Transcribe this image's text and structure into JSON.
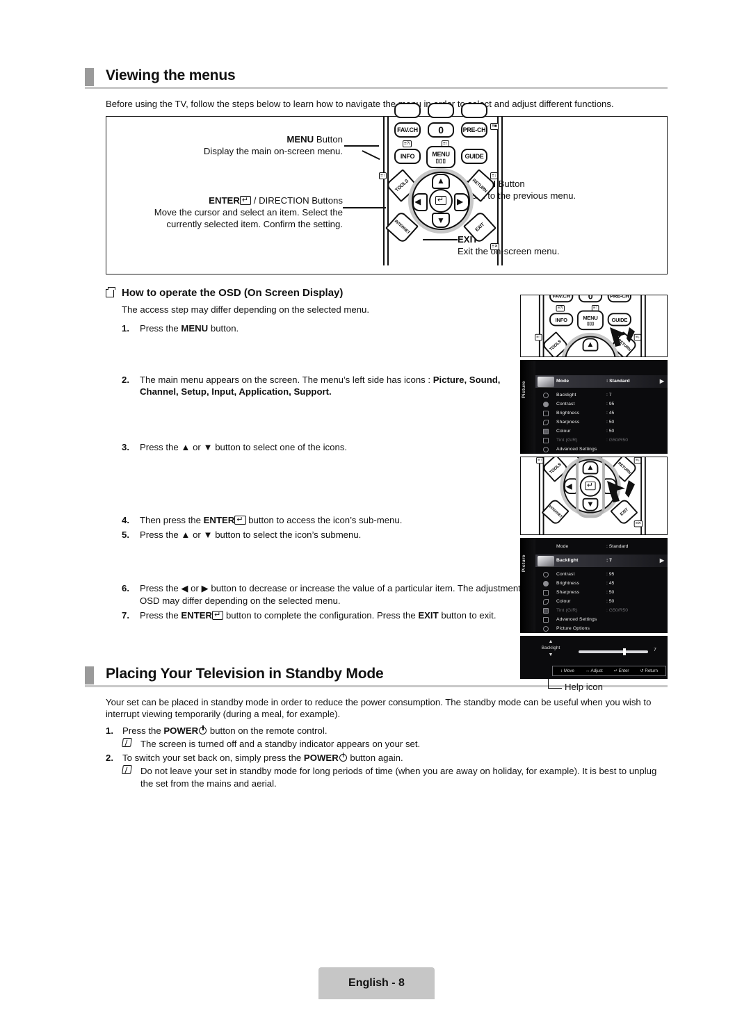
{
  "page": {
    "footer_label": "English - 8"
  },
  "section1": {
    "title": "Viewing the menus",
    "intro": "Before using the TV, follow the steps below to learn how to navigate the menu in order to select and adjust different functions.",
    "diagram": {
      "menu_label_bold": "MENU",
      "menu_label_rest": " Button",
      "menu_desc": "Display the main on-screen menu.",
      "enter_label_bold": "ENTER",
      "enter_label_rest": " / DIRECTION Buttons",
      "enter_desc": "Move the cursor and select an item. Select the currently selected item. Confirm the setting.",
      "return_label_bold": "RETURN",
      "return_label_rest": " Button",
      "return_desc": "Return to the previous menu.",
      "exit_label_bold": "EXIT",
      "exit_desc": "Exit the on-screen menu.",
      "remote_buttons": {
        "fav_ch": "FAV.CH",
        "zero": "0",
        "pre_ch": "PRE-CH",
        "info": "INFO",
        "menu": "MENU",
        "guide": "GUIDE",
        "tools": "TOOLS",
        "return": "RETURN",
        "internet": "INTERNET",
        "exit": "EXIT"
      }
    }
  },
  "osd_section": {
    "heading": "How to operate the OSD (On Screen Display)",
    "note": "The access step may differ depending on the selected menu.",
    "steps": [
      {
        "n": "1.",
        "parts": [
          {
            "t": "Press the ",
            "b": false
          },
          {
            "t": "MENU",
            "b": true
          },
          {
            "t": " button.",
            "b": false
          }
        ]
      },
      {
        "n": "2.",
        "parts": [
          {
            "t": "The main menu appears on the screen. The menu’s left side has icons : ",
            "b": false
          },
          {
            "t": "Picture, Sound, Channel, Setup, Input, Application, Support.",
            "b": true
          }
        ]
      },
      {
        "n": "3.",
        "parts": [
          {
            "t": "Press the ▲ or ▼ button to select one of the icons.",
            "b": false
          }
        ]
      },
      {
        "n": "4.",
        "parts": [
          {
            "t": "Then press the ",
            "b": false
          },
          {
            "t": "ENTER",
            "b": true
          },
          {
            "t": "ENTERKEY",
            "b": false
          },
          {
            "t": " button to access the icon’s sub-menu.",
            "b": false
          }
        ]
      },
      {
        "n": "5.",
        "parts": [
          {
            "t": "Press the ▲ or ▼ button to select the icon’s submenu.",
            "b": false
          }
        ]
      },
      {
        "n": "6.",
        "parts": [
          {
            "t": "Press the ◀ or ▶ button to decrease or increase the value of a particular item. The adjustment OSD may differ depending on the selected menu.",
            "b": false
          }
        ]
      },
      {
        "n": "7.",
        "parts": [
          {
            "t": "Press the ",
            "b": false
          },
          {
            "t": "ENTER",
            "b": true
          },
          {
            "t": "ENTERKEY",
            "b": false
          },
          {
            "t": " button to complete the configuration. Press the ",
            "b": false
          },
          {
            "t": "EXIT",
            "b": true
          },
          {
            "t": " button to exit.",
            "b": false
          }
        ]
      }
    ],
    "help_icon_caption": "Help icon"
  },
  "osd_menu_1": {
    "sidebar_label": "Picture",
    "rows": [
      {
        "icon": "tv-icon",
        "name": "Mode",
        "value": ": Standard",
        "state": "selected",
        "arrow": "▶"
      },
      {
        "icon": "backlight-icon",
        "name": "Backlight",
        "value": ": 7",
        "state": "normal",
        "arrow": ""
      },
      {
        "icon": "contrast-icon",
        "name": "Contrast",
        "value": ": 95",
        "state": "normal",
        "arrow": ""
      },
      {
        "icon": "brightness-icon",
        "name": "Brightness",
        "value": ": 45",
        "state": "normal",
        "arrow": ""
      },
      {
        "icon": "sharpness-icon",
        "name": "Sharpness",
        "value": ": 50",
        "state": "normal",
        "arrow": ""
      },
      {
        "icon": "colour-icon",
        "name": "Colour",
        "value": ": 50",
        "state": "normal",
        "arrow": ""
      },
      {
        "icon": "tint-icon",
        "name": "Tint (G/R)",
        "value": ": G50/R50",
        "state": "dim",
        "arrow": ""
      },
      {
        "icon": "advanced-icon",
        "name": "Advanced Settings",
        "value": "",
        "state": "normal",
        "arrow": ""
      }
    ]
  },
  "osd_menu_2": {
    "sidebar_label": "Picture",
    "rows": [
      {
        "icon": "none",
        "name": "Mode",
        "value": ": Standard",
        "state": "normal",
        "arrow": ""
      },
      {
        "icon": "tv-icon",
        "name": "Backlight",
        "value": ": 7",
        "state": "selected",
        "arrow": "▶"
      },
      {
        "icon": "contrast-icon",
        "name": "Contrast",
        "value": ": 95",
        "state": "normal",
        "arrow": ""
      },
      {
        "icon": "brightness-icon",
        "name": "Brightness",
        "value": ": 45",
        "state": "normal",
        "arrow": ""
      },
      {
        "icon": "sharpness-icon",
        "name": "Sharpness",
        "value": ": 50",
        "state": "normal",
        "arrow": ""
      },
      {
        "icon": "colour-icon",
        "name": "Colour",
        "value": ": 50",
        "state": "normal",
        "arrow": ""
      },
      {
        "icon": "tint-icon",
        "name": "Tint (G/R)",
        "value": ": G50/R50",
        "state": "dim",
        "arrow": ""
      },
      {
        "icon": "advanced-icon",
        "name": "Advanced Settings",
        "value": "",
        "state": "normal",
        "arrow": ""
      },
      {
        "icon": "options-icon",
        "name": "Picture Options",
        "value": "",
        "state": "normal",
        "arrow": ""
      }
    ]
  },
  "osd_slider": {
    "label": "Backlight",
    "up_glyph": "▲",
    "down_glyph": "▼",
    "value": "7",
    "help": [
      {
        "glyph": "↕",
        "label": "Move"
      },
      {
        "glyph": "↔",
        "label": "Adjust"
      },
      {
        "glyph": "↵",
        "label": "Enter"
      },
      {
        "glyph": "↺",
        "label": "Return"
      }
    ]
  },
  "section2": {
    "title": "Placing Your Television in Standby Mode",
    "body": "Your set can be placed in standby mode in order to reduce the power consumption. The standby mode can be useful when you wish to interrupt viewing temporarily (during a meal, for example).",
    "step1_a": "Press the ",
    "step1_b": "POWER",
    "step1_c": " button on the remote control.",
    "note1": "The screen is turned off and a standby indicator appears on your set.",
    "step2_a": "To switch your set back on, simply press the ",
    "step2_b": "POWER",
    "step2_c": " button again.",
    "note2": "Do not leave your set in standby mode for long periods of time (when you are away on holiday, for example). It is best to unplug the set from the mains and aerial.",
    "n1": "1.",
    "n2": "2."
  },
  "colors": {
    "heading_bar": "#9a9a9a",
    "rule": "#c9c9c9",
    "footer_bg": "#c6c6c6",
    "osd_bg": "#0b0b0d",
    "dpad_ring": "#c8c8c8"
  }
}
